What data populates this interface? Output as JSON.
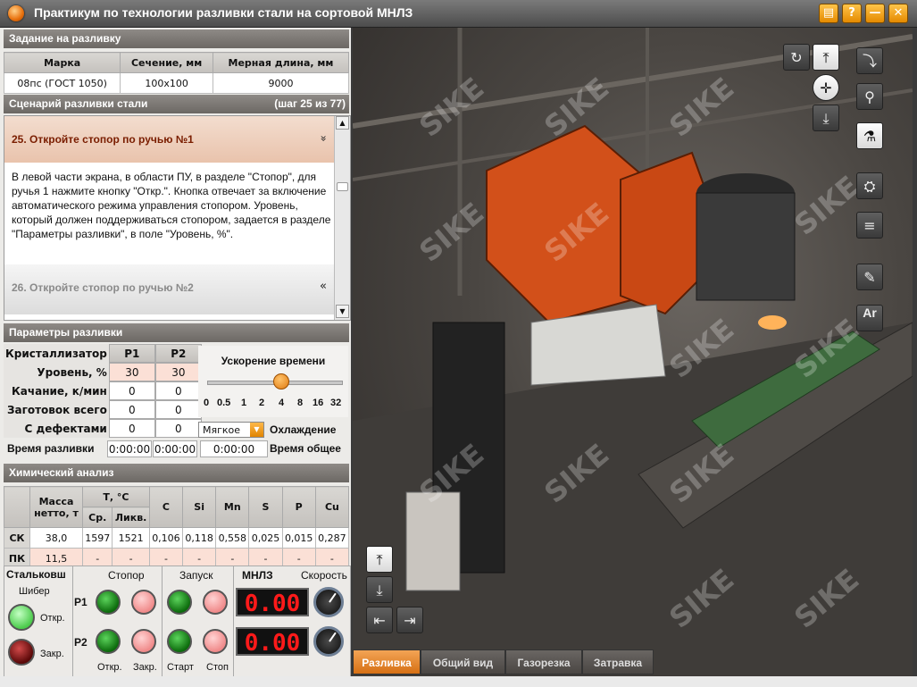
{
  "window": {
    "title": "Практикум по технологии разливки стали на сортовой МНЛЗ",
    "buttons": {
      "help": "?",
      "minimize": "—",
      "close": "✕"
    }
  },
  "task": {
    "title": "Задание на разливку",
    "columns": [
      "Марка",
      "Сечение, мм",
      "Мерная длина, мм"
    ],
    "values": [
      "08пс (ГОСТ 1050)",
      "100x100",
      "9000"
    ]
  },
  "scenario": {
    "title": "Сценарий разливки стали",
    "step_info": "(шаг 25 из 77)",
    "current_step": "25. Откройте стопор по ручью №1",
    "current_chevron": "»",
    "description": "В левой части экрана, в области ПУ, в разделе \"Стопор\", для ручья 1 нажмите кнопку \"Откр.\". Кнопка отвечает за включение автоматического режима управления стопором. Уровень, который должен поддерживаться стопором, задается в разделе \"Параметры разливки\", в поле \"Уровень, %\".",
    "next_step": "26. Откройте стопор по ручью №2",
    "next_chevron": "«"
  },
  "params": {
    "title": "Параметры разливки",
    "header": {
      "label": "Кристаллизатор",
      "p1": "Р1",
      "p2": "Р2"
    },
    "rows": [
      {
        "label": "Уровень, %",
        "p1": "30",
        "p2": "30"
      },
      {
        "label": "Качание, к/мин",
        "p1": "0",
        "p2": "0"
      },
      {
        "label": "Заготовок всего",
        "p1": "0",
        "p2": "0"
      },
      {
        "label": "С дефектами",
        "p1": "0",
        "p2": "0"
      }
    ],
    "time_label": "Время разливки",
    "time_p1": "0:00:00",
    "time_p2": "0:00:00",
    "accel_title": "Ускорение времени",
    "accel_ticks": [
      "0",
      "0.5",
      "1",
      "2",
      "4",
      "8",
      "16",
      "32"
    ],
    "accel_selected_value": "4",
    "cooling_value": "Мягкое",
    "cooling_label": "Охлаждение",
    "total_time": "0:00:00",
    "total_time_label": "Время общее"
  },
  "chem": {
    "title": "Химический анализ",
    "headers": {
      "mass": "Масса нетто, т",
      "temp": "Т, °С",
      "t_avg": "Ср.",
      "t_liq": "Ликв.",
      "c": "C",
      "si": "Si",
      "mn": "Mn",
      "s": "S",
      "p": "P",
      "cu": "Cu"
    },
    "rows": [
      {
        "label": "СК",
        "mass": "38,0",
        "t_avg": "1597",
        "t_liq": "1521",
        "c": "0,106",
        "si": "0,118",
        "mn": "0,558",
        "s": "0,025",
        "p": "0,015",
        "cu": "0,287"
      },
      {
        "label": "ПК",
        "mass": "11,5",
        "t_avg": "-",
        "t_liq": "-",
        "c": "-",
        "si": "-",
        "mn": "-",
        "s": "-",
        "p": "-",
        "cu": "-"
      }
    ]
  },
  "controls": {
    "ladle_label": "Стальковш",
    "gate_label": "Шибер",
    "gate_open": "Откр.",
    "gate_close": "Закр.",
    "stopper_label": "Стопор",
    "start_label": "Запуск",
    "ccm_label": "МНЛЗ",
    "speed_label": "Скорость",
    "strand1": "Р1",
    "strand2": "Р2",
    "open_label": "Откр.",
    "close_label": "Закр.",
    "start_btn": "Старт",
    "stop_btn": "Стоп",
    "speed1": "0.00",
    "speed2": "0.00"
  },
  "scene": {
    "watermark": "SIKE",
    "tabs": [
      "Разливка",
      "Общий вид",
      "Газорезка",
      "Затравка"
    ],
    "active_tab": "Разливка",
    "toolbar_text_icon": "Ar"
  },
  "colors": {
    "accent": "#e8820c",
    "speed_display": "#ff1a1a"
  }
}
